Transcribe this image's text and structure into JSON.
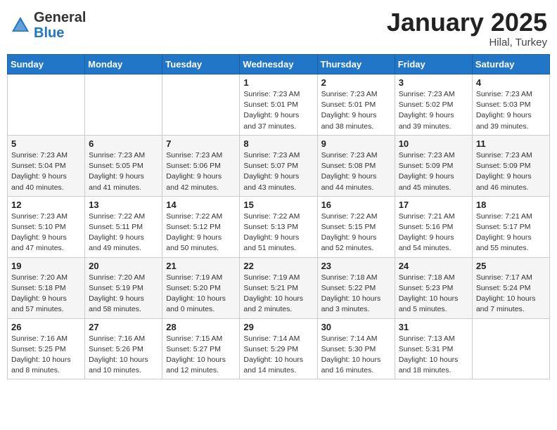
{
  "header": {
    "logo_general": "General",
    "logo_blue": "Blue",
    "month_title": "January 2025",
    "location": "Hilal, Turkey"
  },
  "weekdays": [
    "Sunday",
    "Monday",
    "Tuesday",
    "Wednesday",
    "Thursday",
    "Friday",
    "Saturday"
  ],
  "weeks": [
    [
      {
        "day": "",
        "info": ""
      },
      {
        "day": "",
        "info": ""
      },
      {
        "day": "",
        "info": ""
      },
      {
        "day": "1",
        "info": "Sunrise: 7:23 AM\nSunset: 5:01 PM\nDaylight: 9 hours\nand 37 minutes."
      },
      {
        "day": "2",
        "info": "Sunrise: 7:23 AM\nSunset: 5:01 PM\nDaylight: 9 hours\nand 38 minutes."
      },
      {
        "day": "3",
        "info": "Sunrise: 7:23 AM\nSunset: 5:02 PM\nDaylight: 9 hours\nand 39 minutes."
      },
      {
        "day": "4",
        "info": "Sunrise: 7:23 AM\nSunset: 5:03 PM\nDaylight: 9 hours\nand 39 minutes."
      }
    ],
    [
      {
        "day": "5",
        "info": "Sunrise: 7:23 AM\nSunset: 5:04 PM\nDaylight: 9 hours\nand 40 minutes."
      },
      {
        "day": "6",
        "info": "Sunrise: 7:23 AM\nSunset: 5:05 PM\nDaylight: 9 hours\nand 41 minutes."
      },
      {
        "day": "7",
        "info": "Sunrise: 7:23 AM\nSunset: 5:06 PM\nDaylight: 9 hours\nand 42 minutes."
      },
      {
        "day": "8",
        "info": "Sunrise: 7:23 AM\nSunset: 5:07 PM\nDaylight: 9 hours\nand 43 minutes."
      },
      {
        "day": "9",
        "info": "Sunrise: 7:23 AM\nSunset: 5:08 PM\nDaylight: 9 hours\nand 44 minutes."
      },
      {
        "day": "10",
        "info": "Sunrise: 7:23 AM\nSunset: 5:09 PM\nDaylight: 9 hours\nand 45 minutes."
      },
      {
        "day": "11",
        "info": "Sunrise: 7:23 AM\nSunset: 5:09 PM\nDaylight: 9 hours\nand 46 minutes."
      }
    ],
    [
      {
        "day": "12",
        "info": "Sunrise: 7:23 AM\nSunset: 5:10 PM\nDaylight: 9 hours\nand 47 minutes."
      },
      {
        "day": "13",
        "info": "Sunrise: 7:22 AM\nSunset: 5:11 PM\nDaylight: 9 hours\nand 49 minutes."
      },
      {
        "day": "14",
        "info": "Sunrise: 7:22 AM\nSunset: 5:12 PM\nDaylight: 9 hours\nand 50 minutes."
      },
      {
        "day": "15",
        "info": "Sunrise: 7:22 AM\nSunset: 5:13 PM\nDaylight: 9 hours\nand 51 minutes."
      },
      {
        "day": "16",
        "info": "Sunrise: 7:22 AM\nSunset: 5:15 PM\nDaylight: 9 hours\nand 52 minutes."
      },
      {
        "day": "17",
        "info": "Sunrise: 7:21 AM\nSunset: 5:16 PM\nDaylight: 9 hours\nand 54 minutes."
      },
      {
        "day": "18",
        "info": "Sunrise: 7:21 AM\nSunset: 5:17 PM\nDaylight: 9 hours\nand 55 minutes."
      }
    ],
    [
      {
        "day": "19",
        "info": "Sunrise: 7:20 AM\nSunset: 5:18 PM\nDaylight: 9 hours\nand 57 minutes."
      },
      {
        "day": "20",
        "info": "Sunrise: 7:20 AM\nSunset: 5:19 PM\nDaylight: 9 hours\nand 58 minutes."
      },
      {
        "day": "21",
        "info": "Sunrise: 7:19 AM\nSunset: 5:20 PM\nDaylight: 10 hours\nand 0 minutes."
      },
      {
        "day": "22",
        "info": "Sunrise: 7:19 AM\nSunset: 5:21 PM\nDaylight: 10 hours\nand 2 minutes."
      },
      {
        "day": "23",
        "info": "Sunrise: 7:18 AM\nSunset: 5:22 PM\nDaylight: 10 hours\nand 3 minutes."
      },
      {
        "day": "24",
        "info": "Sunrise: 7:18 AM\nSunset: 5:23 PM\nDaylight: 10 hours\nand 5 minutes."
      },
      {
        "day": "25",
        "info": "Sunrise: 7:17 AM\nSunset: 5:24 PM\nDaylight: 10 hours\nand 7 minutes."
      }
    ],
    [
      {
        "day": "26",
        "info": "Sunrise: 7:16 AM\nSunset: 5:25 PM\nDaylight: 10 hours\nand 8 minutes."
      },
      {
        "day": "27",
        "info": "Sunrise: 7:16 AM\nSunset: 5:26 PM\nDaylight: 10 hours\nand 10 minutes."
      },
      {
        "day": "28",
        "info": "Sunrise: 7:15 AM\nSunset: 5:27 PM\nDaylight: 10 hours\nand 12 minutes."
      },
      {
        "day": "29",
        "info": "Sunrise: 7:14 AM\nSunset: 5:29 PM\nDaylight: 10 hours\nand 14 minutes."
      },
      {
        "day": "30",
        "info": "Sunrise: 7:14 AM\nSunset: 5:30 PM\nDaylight: 10 hours\nand 16 minutes."
      },
      {
        "day": "31",
        "info": "Sunrise: 7:13 AM\nSunset: 5:31 PM\nDaylight: 10 hours\nand 18 minutes."
      },
      {
        "day": "",
        "info": ""
      }
    ]
  ]
}
